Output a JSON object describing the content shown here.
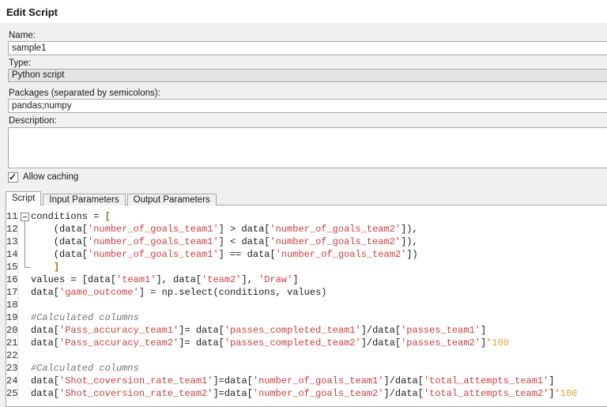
{
  "window": {
    "title": "Edit Script"
  },
  "form": {
    "name": {
      "label": "Name:",
      "value": "sample1"
    },
    "type": {
      "label": "Type:",
      "value": "Python script"
    },
    "packages": {
      "label": "Packages (separated by semicolons):",
      "value": "pandas;numpy"
    },
    "description": {
      "label": "Description:",
      "value": ""
    },
    "allow_caching": {
      "label": "Allow caching",
      "checked": true,
      "checkmark_icon": "✓"
    }
  },
  "tabs": [
    {
      "label": "Script",
      "active": true
    },
    {
      "label": "Input Parameters",
      "active": false
    },
    {
      "label": "Output Parameters",
      "active": false
    }
  ],
  "editor": {
    "language": "python",
    "token_colors": {
      "d": "#1b1b1b",
      "s": "#cd3d3d",
      "n": "#dfa32f",
      "c": "#757575",
      "b": "#8f7a1e"
    },
    "lines": [
      {
        "number": 11,
        "fold": "open",
        "tokens": [
          {
            "t": "conditions = ",
            "c": "d"
          },
          {
            "t": "[",
            "c": "b"
          }
        ]
      },
      {
        "number": 12,
        "fold": "line",
        "tokens": [
          {
            "t": "    (data[",
            "c": "d"
          },
          {
            "t": "'number_of_goals_team1'",
            "c": "s"
          },
          {
            "t": "] > data[",
            "c": "d"
          },
          {
            "t": "'number_of_goals_team2'",
            "c": "s"
          },
          {
            "t": "]),",
            "c": "d"
          }
        ]
      },
      {
        "number": 13,
        "fold": "line",
        "tokens": [
          {
            "t": "    (data[",
            "c": "d"
          },
          {
            "t": "'number_of_goals_team1'",
            "c": "s"
          },
          {
            "t": "] < data[",
            "c": "d"
          },
          {
            "t": "'number_of_goals_team2'",
            "c": "s"
          },
          {
            "t": "]),",
            "c": "d"
          }
        ]
      },
      {
        "number": 14,
        "fold": "line",
        "tokens": [
          {
            "t": "    (data[",
            "c": "d"
          },
          {
            "t": "'number_of_goals_team1'",
            "c": "s"
          },
          {
            "t": "] == data[",
            "c": "d"
          },
          {
            "t": "'number_of_goals_team2'",
            "c": "s"
          },
          {
            "t": "])",
            "c": "d"
          }
        ]
      },
      {
        "number": 15,
        "fold": "end",
        "tokens": [
          {
            "t": "    ",
            "c": "d"
          },
          {
            "t": "]",
            "c": "b"
          }
        ]
      },
      {
        "number": 16,
        "fold": null,
        "tokens": [
          {
            "t": "values = [data[",
            "c": "d"
          },
          {
            "t": "'team1'",
            "c": "s"
          },
          {
            "t": "], data[",
            "c": "d"
          },
          {
            "t": "'team2'",
            "c": "s"
          },
          {
            "t": "], ",
            "c": "d"
          },
          {
            "t": "'Draw'",
            "c": "s"
          },
          {
            "t": "]",
            "c": "d"
          }
        ]
      },
      {
        "number": 17,
        "fold": null,
        "tokens": [
          {
            "t": "data[",
            "c": "d"
          },
          {
            "t": "'game_outcome'",
            "c": "s"
          },
          {
            "t": "] = np.select(conditions, values)",
            "c": "d"
          }
        ]
      },
      {
        "number": 18,
        "fold": null,
        "tokens": []
      },
      {
        "number": 19,
        "fold": null,
        "tokens": [
          {
            "t": "#Calculated columns",
            "c": "c"
          }
        ]
      },
      {
        "number": 20,
        "fold": null,
        "tokens": [
          {
            "t": "data[",
            "c": "d"
          },
          {
            "t": "'Pass_accuracy_team1'",
            "c": "s"
          },
          {
            "t": "]= data[",
            "c": "d"
          },
          {
            "t": "'passes_completed_team1'",
            "c": "s"
          },
          {
            "t": "]/data[",
            "c": "d"
          },
          {
            "t": "'passes_team1'",
            "c": "s"
          },
          {
            "t": "]",
            "c": "d"
          }
        ]
      },
      {
        "number": 21,
        "fold": null,
        "tokens": [
          {
            "t": "data[",
            "c": "d"
          },
          {
            "t": "'Pass_accuracy_team2'",
            "c": "s"
          },
          {
            "t": "]= data[",
            "c": "d"
          },
          {
            "t": "'passes_completed_team2'",
            "c": "s"
          },
          {
            "t": "]/data[",
            "c": "d"
          },
          {
            "t": "'passes_team2'",
            "c": "s"
          },
          {
            "t": "]",
            "c": "d"
          },
          {
            "t": "*100",
            "c": "n"
          }
        ]
      },
      {
        "number": 22,
        "fold": null,
        "tokens": []
      },
      {
        "number": 23,
        "fold": null,
        "tokens": [
          {
            "t": "#Calculated columns",
            "c": "c"
          }
        ]
      },
      {
        "number": 24,
        "fold": null,
        "tokens": [
          {
            "t": "data[",
            "c": "d"
          },
          {
            "t": "'Shot_coversion_rate_team1'",
            "c": "s"
          },
          {
            "t": "]=data[",
            "c": "d"
          },
          {
            "t": "'number_of_goals_team1'",
            "c": "s"
          },
          {
            "t": "]/data[",
            "c": "d"
          },
          {
            "t": "'total_attempts_team1'",
            "c": "s"
          },
          {
            "t": "]",
            "c": "d"
          }
        ]
      },
      {
        "number": 25,
        "fold": null,
        "tokens": [
          {
            "t": "data[",
            "c": "d"
          },
          {
            "t": "'Shot_coversion_rate_team2'",
            "c": "s"
          },
          {
            "t": "]=data[",
            "c": "d"
          },
          {
            "t": "'number_of_goals_team2'",
            "c": "s"
          },
          {
            "t": "]/data[",
            "c": "d"
          },
          {
            "t": "'total_attempts_team2'",
            "c": "s"
          },
          {
            "t": "]",
            "c": "d"
          },
          {
            "t": "*100",
            "c": "n"
          }
        ]
      }
    ]
  }
}
